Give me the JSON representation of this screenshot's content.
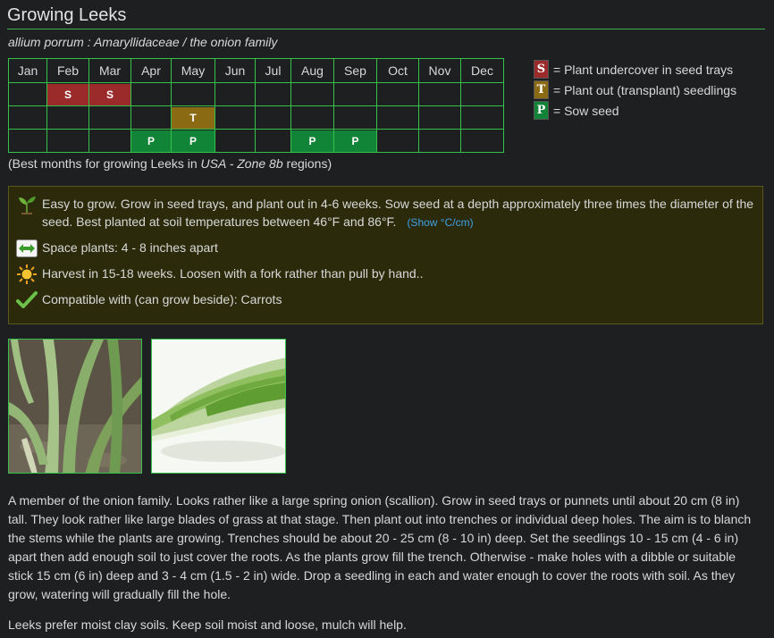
{
  "page": {
    "title": "Growing Leeks",
    "subtitle": "allium porrum : Amaryllidaceae / the onion family"
  },
  "calendar": {
    "months": [
      "Jan",
      "Feb",
      "Mar",
      "Apr",
      "May",
      "Jun",
      "Jul",
      "Aug",
      "Sep",
      "Oct",
      "Nov",
      "Dec"
    ],
    "rows": [
      [
        "",
        "S",
        "S",
        "",
        "",
        "",
        "",
        "",
        "",
        "",
        "",
        ""
      ],
      [
        "",
        "",
        "",
        "",
        "T",
        "",
        "",
        "",
        "",
        "",
        "",
        ""
      ],
      [
        "",
        "",
        "",
        "P",
        "P",
        "",
        "",
        "P",
        "P",
        "",
        "",
        ""
      ]
    ],
    "code_colors": {
      "S": "#9b2a2a",
      "T": "#8a6a12",
      "P": "#118437"
    },
    "note_prefix": "(Best months for growing Leeks in ",
    "note_region": "USA - Zone 8b",
    "note_suffix": " regions)"
  },
  "legend": [
    {
      "key": "S",
      "text": "= Plant undercover in seed trays"
    },
    {
      "key": "T",
      "text": "= Plant out (transplant) seedlings"
    },
    {
      "key": "P",
      "text": "= Sow seed"
    }
  ],
  "info": {
    "grow": "Easy to grow. Grow in seed trays, and plant out in 4-6 weeks. Sow seed at a depth approximately three times the diameter of the seed. Best planted at soil temperatures between 46°F and 86°F.",
    "show_units": "(Show °C/cm)",
    "spacing": "Space plants: 4 - 8 inches apart",
    "harvest": "Harvest in 15-18 weeks. Loosen with a fork rather than pull by hand..",
    "compatible": "Compatible with (can grow beside): Carrots"
  },
  "description": {
    "p1": "A member of the onion family. Looks rather like a large spring onion (scallion). Grow in seed trays or punnets until about 20 cm (8 in) tall. They look rather like large blades of grass at that stage. Then plant out into trenches or individual deep holes. The aim is to blanch the stems while the plants are growing. Trenches should be about 20 - 25 cm (8 - 10 in) deep. Set the seedlings 10 - 15 cm (4 - 6 in) apart then add enough soil to just cover the roots. As the plants grow fill the trench. Otherwise - make holes with a dibble or suitable stick 15 cm (6 in) deep and 3 - 4 cm (1.5 - 2 in) wide. Drop a seedling in each and water enough to cover the roots with soil. As they grow, watering will gradually fill the hole.",
    "p2": "Leeks prefer moist clay soils. Keep soil moist and loose, mulch will help."
  },
  "icons": {
    "grow": "seedling-icon",
    "spacing": "spacing-arrows-icon",
    "harvest": "sun-icon",
    "compatible": "checkmark-icon"
  }
}
